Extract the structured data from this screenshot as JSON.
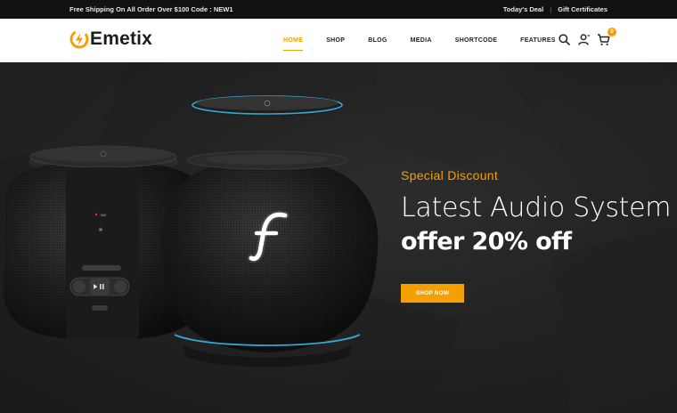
{
  "topbar": {
    "promo": "Free Shipping On All Order Over $100 Code : NEW1",
    "links": [
      "Today's Deal",
      "Gift Certificates"
    ],
    "separator": "|"
  },
  "brand": {
    "name": "Emetix",
    "accent": "#f5a000"
  },
  "nav": {
    "items": [
      {
        "label": "HOME",
        "active": true
      },
      {
        "label": "SHOP"
      },
      {
        "label": "BLOG"
      },
      {
        "label": "MEDIA"
      },
      {
        "label": "SHORTCODE"
      },
      {
        "label": "FEATURES"
      }
    ]
  },
  "header_icons": {
    "search": "search-icon",
    "account": "user-icon",
    "cart": "cart-icon",
    "cart_count": "0"
  },
  "hero": {
    "kicker": "Special Discount",
    "headline": "Latest Audio System",
    "offer": "offer 20% off",
    "cta": "SHOP NOW",
    "speaker_label": "MIC"
  }
}
